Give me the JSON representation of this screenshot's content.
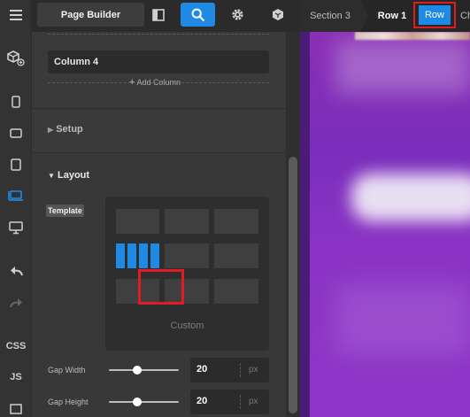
{
  "toolbar": {
    "title": "Page Builder",
    "icons": [
      "panel-toggle-icon",
      "search-icon",
      "gear-icon",
      "cube-icon"
    ]
  },
  "breadcrumb": {
    "items": [
      "Section 3",
      "Row 1",
      "Row",
      "Ch"
    ]
  },
  "rail": {
    "icons": [
      "menu-icon",
      "add-cubes-icon",
      "mobile-icon",
      "tablet-landscape-icon",
      "tablet-icon",
      "laptop-icon",
      "desktop-icon",
      "undo-icon",
      "redo-icon"
    ],
    "labels": [
      "CSS",
      "JS"
    ]
  },
  "panel": {
    "column_label": "Column 4",
    "add_column": "Add Column",
    "setup_heading": "Setup",
    "layout_heading": "Layout",
    "template_label": "Template",
    "custom_label": "Custom",
    "gap_width": {
      "label": "Gap Width",
      "value": "20",
      "unit": "px",
      "slider_fraction": 0.41
    },
    "gap_height": {
      "label": "Gap Height",
      "value": "20",
      "unit": "px",
      "slider_fraction": 0.41
    }
  },
  "colors": {
    "accent": "#1f8ae6",
    "highlight": "#e01b24",
    "panel": "#3a3a3a",
    "preview_purple": "#8b2fb6"
  }
}
